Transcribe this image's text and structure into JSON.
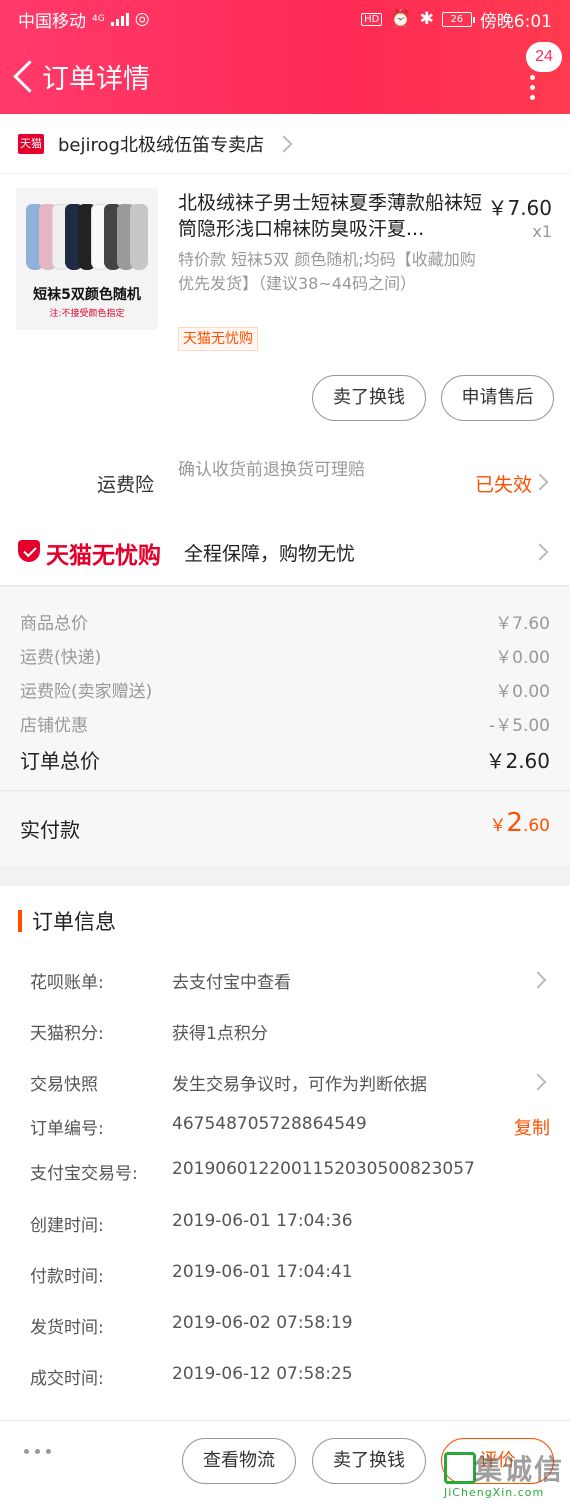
{
  "status_bar": {
    "carrier": "中国移动",
    "network": "4G",
    "battery": "26",
    "time": "傍晚6:01"
  },
  "header": {
    "title": "订单详情",
    "badge": "24"
  },
  "store": {
    "logo_text": "天猫",
    "name": "bejirog北极绒伍笛专卖店"
  },
  "product": {
    "title": "北极绒袜子男士短袜夏季薄款船袜短筒隐形浅口棉袜防臭吸汗夏...",
    "price": "￥7.60",
    "quantity": "x1",
    "sku": "特价款 短袜5双 颜色随机;均码【收藏加购优先发货】（建议38~44码之间）",
    "tag": "天猫无忧购",
    "image_caption": "短袜5双颜色随机",
    "image_note": "注:不接受颜色指定",
    "sell_button": "卖了换钱",
    "aftersale_button": "申请售后"
  },
  "insurance": {
    "label": "运费险",
    "desc": "确认收货前退换货可理赔",
    "status": "已失效"
  },
  "wuyou": {
    "brand": "天猫无忧购",
    "text": "全程保障，购物无忧"
  },
  "summary": {
    "rows": [
      {
        "label": "商品总价",
        "value": "￥7.60"
      },
      {
        "label": "运费(快递)",
        "value": "￥0.00"
      },
      {
        "label": "运费险(卖家赠送)",
        "value": "￥0.00"
      },
      {
        "label": "店铺优惠",
        "value": "-￥5.00"
      }
    ],
    "total_label": "订单总价",
    "total_value": "￥2.60",
    "paid_label": "实付款",
    "paid_currency": "￥",
    "paid_int": "2",
    "paid_dec": ".60"
  },
  "order_info": {
    "title": "订单信息",
    "rows": [
      {
        "label": "花呗账单:",
        "value": "去支付宝中查看"
      },
      {
        "label": "天猫积分:",
        "value": "获得1点积分"
      },
      {
        "label": "交易快照",
        "value": "发生交易争议时，可作为判断依据"
      },
      {
        "label": "订单编号:",
        "value": "467548705728864549"
      },
      {
        "label": "支付宝交易号:",
        "value": "2019060122001152030500823057"
      },
      {
        "label": "创建时间:",
        "value": "2019-06-01 17:04:36"
      },
      {
        "label": "付款时间:",
        "value": "2019-06-01 17:04:41"
      },
      {
        "label": "发货时间:",
        "value": "2019-06-02 07:58:19"
      },
      {
        "label": "成交时间:",
        "value": "2019-06-12 07:58:25"
      }
    ],
    "copy_label": "复制"
  },
  "bottom_bar": {
    "logistics": "查看物流",
    "sell": "卖了换钱",
    "review": "评价"
  },
  "watermark": {
    "text": "集诚信",
    "url": "JiChengXin.com"
  },
  "colors": {
    "header": "#ff2a55",
    "accent": "#ff5000",
    "tmall_red": "#e4002b"
  }
}
